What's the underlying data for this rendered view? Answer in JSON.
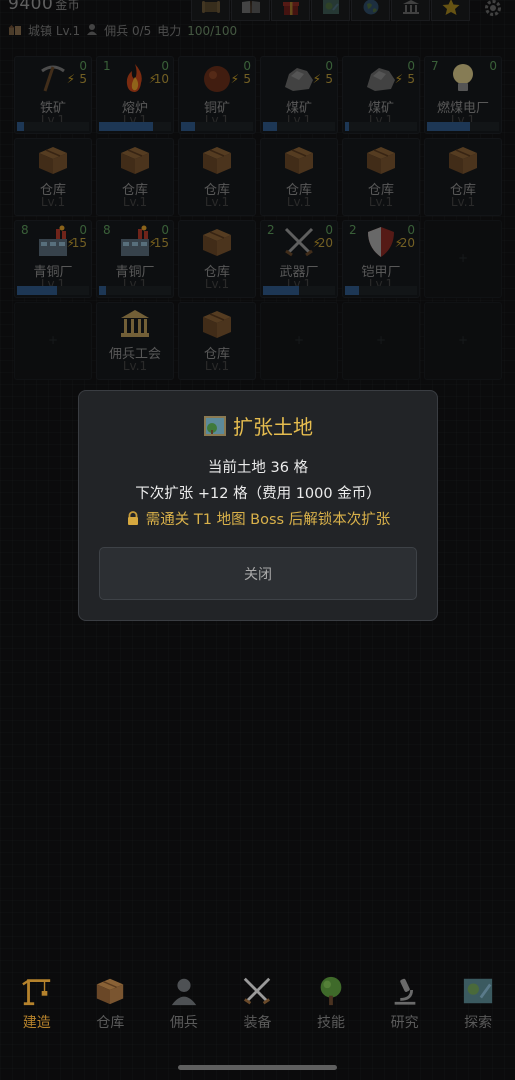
{
  "header": {
    "money_value": "9400",
    "money_unit": "金币",
    "top_icons": [
      "scroll-icon",
      "book-icon",
      "gift-icon",
      "map-icon",
      "globe-icon",
      "bank-icon",
      "star-icon",
      "gear-icon"
    ],
    "town_label": "城镇 Lv.1",
    "mercenary_label": "佣兵 0/5",
    "power_label": "电力",
    "power_value": "100/100"
  },
  "buildings": [
    {
      "name": "铁矿",
      "level": "Lv.1",
      "icon": "pickaxe-icon",
      "count_right": "0",
      "power": "5",
      "progress": 0.1
    },
    {
      "name": "熔炉",
      "level": "Lv.1",
      "icon": "fire-icon",
      "count_left": "1",
      "count_right": "0",
      "power": "10",
      "progress": 0.75
    },
    {
      "name": "铜矿",
      "level": "Lv.1",
      "icon": "copper-ore-icon",
      "count_right": "0",
      "power": "5",
      "progress": 0.2
    },
    {
      "name": "煤矿",
      "level": "Lv.1",
      "icon": "coal-icon",
      "count_right": "0",
      "power": "5",
      "progress": 0.2
    },
    {
      "name": "煤矿",
      "level": "Lv.1",
      "icon": "coal-icon",
      "count_right": "0",
      "power": "5",
      "progress": 0.05
    },
    {
      "name": "燃煤电厂",
      "level": "Lv.1",
      "icon": "light-bulb-icon",
      "count_left": "7",
      "count_right": "0",
      "progress": 0.6
    },
    {
      "name": "仓库",
      "level": "Lv.1",
      "icon": "crate-icon"
    },
    {
      "name": "仓库",
      "level": "Lv.1",
      "icon": "crate-icon"
    },
    {
      "name": "仓库",
      "level": "Lv.1",
      "icon": "crate-icon"
    },
    {
      "name": "仓库",
      "level": "Lv.1",
      "icon": "crate-icon"
    },
    {
      "name": "仓库",
      "level": "Lv.1",
      "icon": "crate-icon"
    },
    {
      "name": "仓库",
      "level": "Lv.1",
      "icon": "crate-icon"
    },
    {
      "name": "青铜厂",
      "level": "Lv.1",
      "icon": "factory-icon",
      "count_left": "8",
      "count_right": "0",
      "power": "15",
      "progress": 0.55
    },
    {
      "name": "青铜厂",
      "level": "Lv.1",
      "icon": "factory-icon",
      "count_left": "8",
      "count_right": "0",
      "power": "15",
      "progress": 0.1
    },
    {
      "name": "仓库",
      "level": "Lv.1",
      "icon": "crate-icon"
    },
    {
      "name": "武器厂",
      "level": "Lv.1",
      "icon": "swords-icon",
      "count_left": "2",
      "count_right": "0",
      "power": "20",
      "progress": 0.5
    },
    {
      "name": "铠甲厂",
      "level": "Lv.1",
      "icon": "shield-icon",
      "count_left": "2",
      "count_right": "0",
      "power": "20",
      "progress": 0.2
    },
    {
      "empty": true
    },
    {
      "empty": true
    },
    {
      "name": "佣兵工会",
      "level": "Lv.1",
      "icon": "guild-hall-icon"
    },
    {
      "name": "仓库",
      "level": "Lv.1",
      "icon": "crate-icon"
    },
    {
      "empty": true
    },
    {
      "empty": true
    },
    {
      "empty": true
    }
  ],
  "modal": {
    "title": "扩张土地",
    "current_land": "当前土地 36 格",
    "next_expand": "下次扩张 +12 格（费用 1000 金币）",
    "lock_notice": "需通关 T1 地图 Boss 后解锁本次扩张",
    "close_label": "关闭"
  },
  "nav": {
    "tabs": [
      {
        "label": "建造",
        "icon": "crane-icon",
        "active": true
      },
      {
        "label": "仓库",
        "icon": "crate-icon",
        "active": false
      },
      {
        "label": "佣兵",
        "icon": "person-icon",
        "active": false
      },
      {
        "label": "装备",
        "icon": "swords-icon",
        "active": false
      },
      {
        "label": "技能",
        "icon": "tree-icon",
        "active": false
      },
      {
        "label": "研究",
        "icon": "microscope-icon",
        "active": false
      },
      {
        "label": "探索",
        "icon": "map-icon",
        "active": false
      }
    ]
  },
  "colors": {
    "accent_gold": "#e6bd4f",
    "active_tab": "#b5822c",
    "progress_blue": "#2f5a8a",
    "count_green": "#5d9a5b"
  }
}
